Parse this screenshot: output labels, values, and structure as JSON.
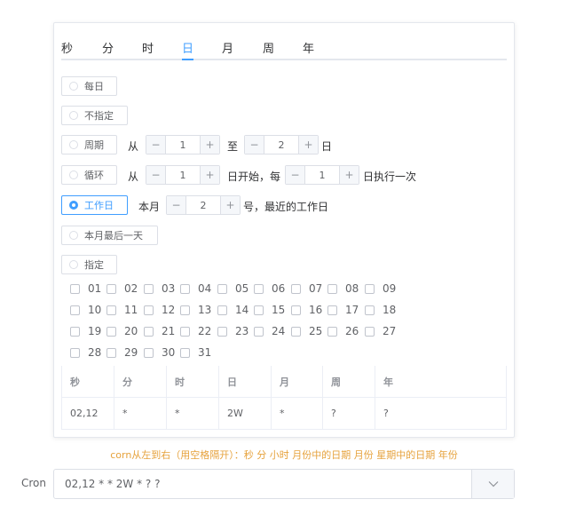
{
  "tabs": [
    "秒",
    "分",
    "时",
    "日",
    "月",
    "周",
    "年"
  ],
  "active_tab": "日",
  "options": {
    "every_day": "每日",
    "unspecified": "不指定",
    "period": {
      "label": "周期",
      "from": "从",
      "start": "1",
      "to": "至",
      "end": "2",
      "unit": "日"
    },
    "loop": {
      "label": "循环",
      "from": "从",
      "start": "1",
      "mid": "日开始，每",
      "every": "1",
      "tail": "日执行一次"
    },
    "workday": {
      "label": "工作日",
      "prefix": "本月",
      "day": "2",
      "suffix": "号，最近的工作日"
    },
    "last_day": "本月最后一天",
    "specify": "指定"
  },
  "days": [
    "01",
    "02",
    "03",
    "04",
    "05",
    "06",
    "07",
    "08",
    "09",
    "10",
    "11",
    "12",
    "13",
    "14",
    "15",
    "16",
    "17",
    "18",
    "19",
    "20",
    "21",
    "22",
    "23",
    "24",
    "25",
    "26",
    "27",
    "28",
    "29",
    "30",
    "31"
  ],
  "table": {
    "headers": [
      "秒",
      "分",
      "时",
      "日",
      "月",
      "周",
      "年"
    ],
    "values": [
      "02,12",
      "*",
      "*",
      "2W",
      "*",
      "?",
      "?"
    ]
  },
  "hint": "corn从左到右（用空格隔开）：秒 分 小时 月份中的日期 月份 星期中的日期 年份",
  "cron": {
    "label": "Cron",
    "value": "02,12 * * 2W * ? ?"
  },
  "colors": {
    "accent": "#409eff",
    "hint": "#e6a23c"
  },
  "icons": {
    "stepper_minus": "minus-icon",
    "stepper_plus": "plus-icon",
    "dropdown": "chevron-down-icon"
  }
}
